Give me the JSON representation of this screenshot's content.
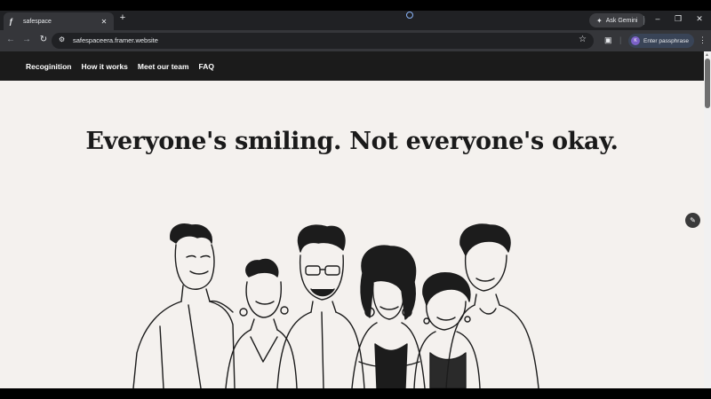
{
  "browser": {
    "tab": {
      "title": "safespace",
      "favicon": "framer-icon"
    },
    "ask_gemini": "Ask Gemini",
    "url": "safespaceera.framer.website",
    "passphrase": {
      "avatar_letter": "K",
      "label": "Enter passphrase"
    }
  },
  "site": {
    "nav": [
      "Recoginition",
      "How it works",
      "Meet our team",
      "FAQ"
    ],
    "headline": "Everyone's smiling. Not everyone's okay.",
    "illustration": "group-of-friends-sketch"
  }
}
